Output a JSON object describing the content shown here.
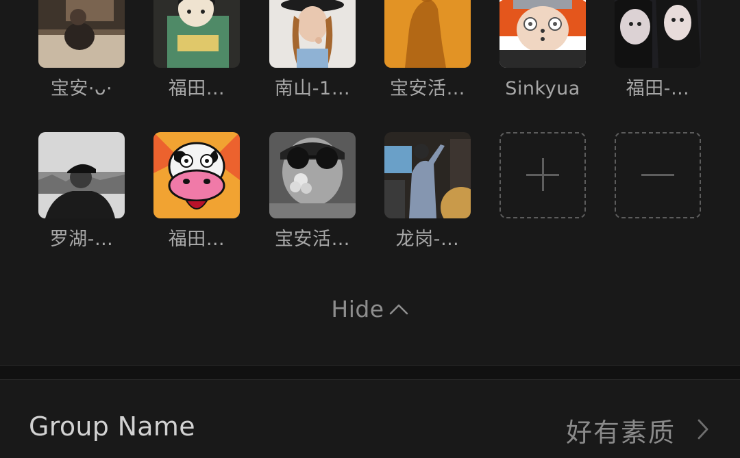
{
  "members": {
    "row1": [
      {
        "name": "宝安·ᴗ·",
        "avatar": "member-photo-desk"
      },
      {
        "name": "福田…",
        "avatar": "member-anime-boy"
      },
      {
        "name": "南山-1…",
        "avatar": "member-girl-hat"
      },
      {
        "name": "宝安活…",
        "avatar": "member-silhouette-orange"
      },
      {
        "name": "Sinkyua",
        "avatar": "member-anime-pain"
      },
      {
        "name": "福田-…",
        "avatar": "member-two-girls"
      }
    ],
    "row2": [
      {
        "name": "罗湖-…",
        "avatar": "member-man-cap"
      },
      {
        "name": "福田…",
        "avatar": "member-cartoon-cow"
      },
      {
        "name": "宝安活…",
        "avatar": "member-sunglasses-flower"
      },
      {
        "name": "龙岗-…",
        "avatar": "member-man-singing"
      }
    ],
    "add_icon": "plus-icon",
    "remove_icon": "minus-icon"
  },
  "toggle": {
    "label": "Hide",
    "icon": "chevron-up-icon"
  },
  "group": {
    "label": "Group Name",
    "value": "好有素质",
    "icon": "chevron-right-icon"
  },
  "colors": {
    "background": "#191919",
    "separator": "#111111",
    "text_primary": "#d2d2d2",
    "text_secondary": "#8a8a8a"
  }
}
